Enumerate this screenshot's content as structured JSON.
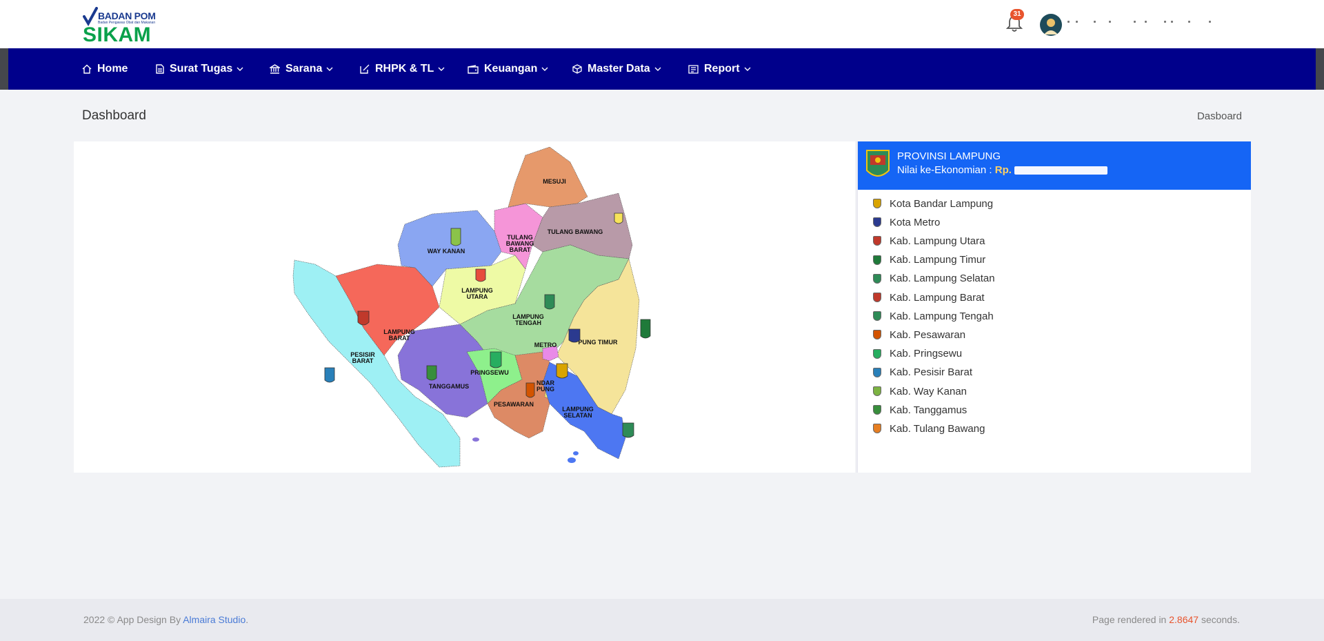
{
  "brand": {
    "org": "BADAN POM",
    "tagline": "Badan Pengawas Obat dan Makanan",
    "app": "SIKAM"
  },
  "header": {
    "notif_count": "31"
  },
  "nav": {
    "home": "Home",
    "surat_tugas": "Surat Tugas",
    "sarana": "Sarana",
    "rhpk": "RHPK & TL",
    "keuangan": "Keuangan",
    "master": "Master Data",
    "report": "Report"
  },
  "page": {
    "title": "Dashboard",
    "breadcrumb": "Dasboard"
  },
  "province": {
    "name": "PROVINSI LAMPUNG",
    "econ_label": "Nilai ke-Ekonomian :",
    "currency": "Rp."
  },
  "map_labels": {
    "mesuji": "MESUJI",
    "tulang_bawang": "TULANG BAWANG",
    "way_kanan": "WAY KANAN",
    "tulang_bawang_barat": [
      "TULANG",
      "BAWANG",
      "BARAT"
    ],
    "lampung_utara": [
      "LAMPUNG",
      "UTARA"
    ],
    "lampung_tengah": [
      "LAMPUNG",
      "TENGAH"
    ],
    "lampung_barat": [
      "LAMPUNG",
      "BARAT"
    ],
    "lampung_timur": "PUNG TIMUR",
    "metro": "METRO",
    "pesisir_barat": [
      "PESISIR",
      "BARAT"
    ],
    "pringsewu": "PRINGSEWU",
    "tanggamus": "TANGGAMUS",
    "bandar_lampung": [
      "NDAR",
      "PUNG"
    ],
    "pesawaran": "PESAWARAN",
    "lampung_selatan": [
      "LAMPUNG",
      "SELATAN"
    ]
  },
  "districts": [
    {
      "name": "Kota Bandar Lampung",
      "color": "#d9a400"
    },
    {
      "name": "Kota Metro",
      "color": "#2b3a8f"
    },
    {
      "name": "Kab. Lampung Utara",
      "color": "#c0392b"
    },
    {
      "name": "Kab. Lampung Timur",
      "color": "#1f7a3a"
    },
    {
      "name": "Kab. Lampung Selatan",
      "color": "#2e8b57"
    },
    {
      "name": "Kab. Lampung Barat",
      "color": "#c0392b"
    },
    {
      "name": "Kab. Lampung Tengah",
      "color": "#2e8b57"
    },
    {
      "name": "Kab. Pesawaran",
      "color": "#d35400"
    },
    {
      "name": "Kab. Pringsewu",
      "color": "#27ae60"
    },
    {
      "name": "Kab. Pesisir Barat",
      "color": "#2980b9"
    },
    {
      "name": "Kab. Way Kanan",
      "color": "#7cb342"
    },
    {
      "name": "Kab. Tanggamus",
      "color": "#388e3c"
    },
    {
      "name": "Kab. Tulang Bawang",
      "color": "#e67e22"
    }
  ],
  "footer": {
    "year": "2022 © App Design By",
    "studio": "Almaira Studio",
    "dot": ".",
    "rendered_pre": "Page rendered in",
    "rendered_num": "2.8647",
    "rendered_post": "seconds."
  }
}
